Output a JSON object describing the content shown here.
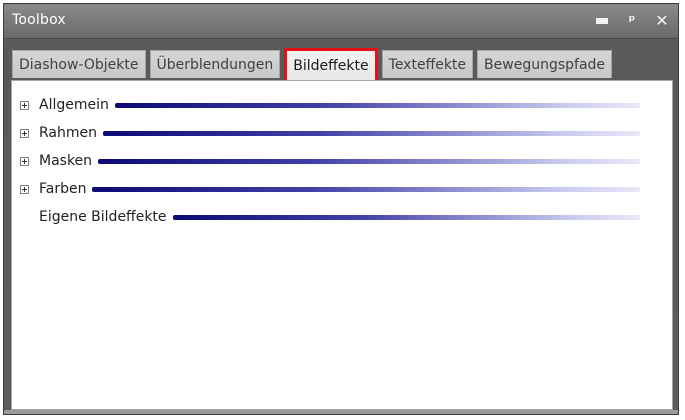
{
  "window": {
    "title": "Toolbox",
    "controls": {
      "minimize_icon": "minimize-icon",
      "pin_icon": "pin-icon",
      "close_icon": "close-icon",
      "pin_glyph": "P",
      "close_glyph": "✕"
    }
  },
  "tabs": [
    {
      "label": "Diashow-Objekte",
      "selected": false
    },
    {
      "label": "Überblendungen",
      "selected": false
    },
    {
      "label": "Bildeffekte",
      "selected": true
    },
    {
      "label": "Texteffekte",
      "selected": false
    },
    {
      "label": "Bewegungspfade",
      "selected": false
    }
  ],
  "tree": [
    {
      "label": "Allgemein",
      "expandable": true
    },
    {
      "label": "Rahmen",
      "expandable": true
    },
    {
      "label": "Masken",
      "expandable": true
    },
    {
      "label": "Farben",
      "expandable": true
    },
    {
      "label": "Eigene Bildeffekte",
      "expandable": false
    }
  ],
  "colors": {
    "selected_tab_highlight": "#e31217",
    "category_line_start": "#0a0a78",
    "category_line_end": "#e8e8f8"
  }
}
